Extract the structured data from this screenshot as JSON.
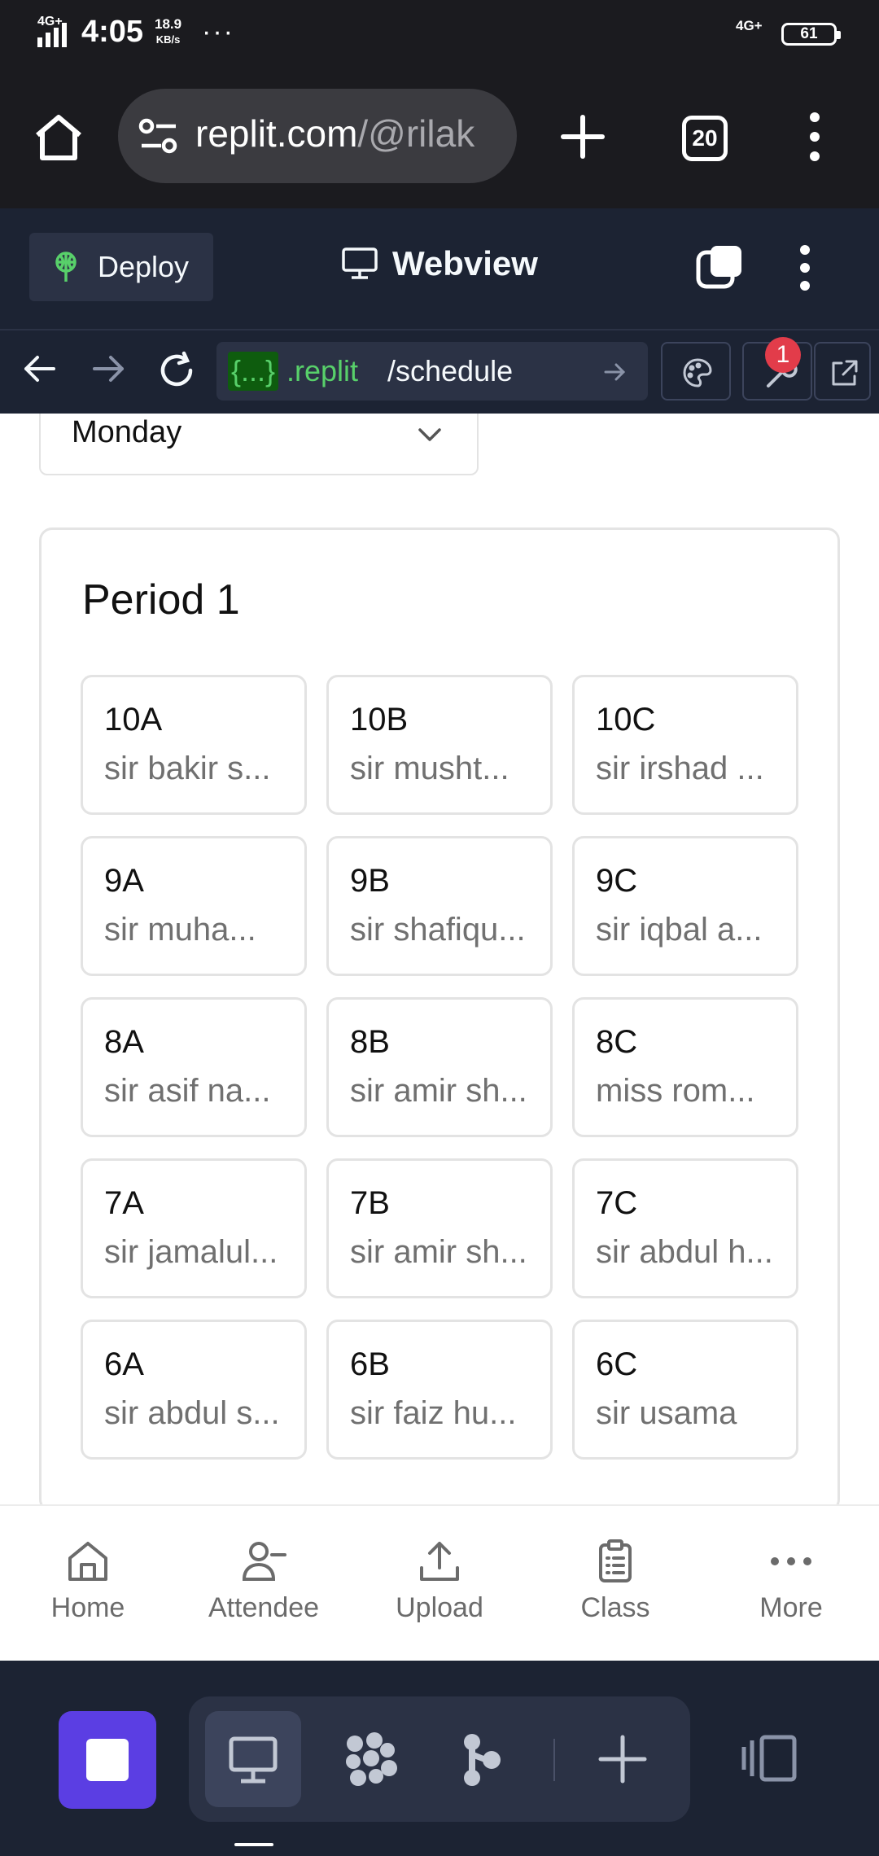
{
  "status_bar": {
    "network_left": "4G+",
    "time": "4:05",
    "net_speed_value": "18.9",
    "net_speed_unit": "KB/s",
    "overflow": "···",
    "network_right": "4G+",
    "battery": "61"
  },
  "browser": {
    "url_host": "replit.com",
    "url_rest": "/@rilak",
    "tab_count": "20"
  },
  "replit_header": {
    "deploy_label": "Deploy",
    "webview_label": "Webview"
  },
  "url_bar": {
    "badge": "{...}",
    "domain": ".replit",
    "path": "/schedule",
    "notification_count": "1"
  },
  "schedule": {
    "day": "Monday",
    "period_title": "Period 1",
    "cells": [
      {
        "cls": "10A",
        "teacher": "sir bakir s..."
      },
      {
        "cls": "10B",
        "teacher": "sir musht..."
      },
      {
        "cls": "10C",
        "teacher": "sir irshad ..."
      },
      {
        "cls": "9A",
        "teacher": "sir muha..."
      },
      {
        "cls": "9B",
        "teacher": "sir shafiqu..."
      },
      {
        "cls": "9C",
        "teacher": "sir iqbal a..."
      },
      {
        "cls": "8A",
        "teacher": "sir asif na..."
      },
      {
        "cls": "8B",
        "teacher": "sir amir sh..."
      },
      {
        "cls": "8C",
        "teacher": "miss rom..."
      },
      {
        "cls": "7A",
        "teacher": "sir jamalul..."
      },
      {
        "cls": "7B",
        "teacher": "sir amir sh..."
      },
      {
        "cls": "7C",
        "teacher": "sir abdul h..."
      },
      {
        "cls": "6A",
        "teacher": "sir abdul s..."
      },
      {
        "cls": "6B",
        "teacher": "sir faiz hu..."
      },
      {
        "cls": "6C",
        "teacher": "sir usama"
      }
    ]
  },
  "app_nav": [
    {
      "label": "Home",
      "icon": "home-icon"
    },
    {
      "label": "Attendee",
      "icon": "user-minus-icon"
    },
    {
      "label": "Upload",
      "icon": "upload-icon"
    },
    {
      "label": "Class",
      "icon": "clipboard-icon"
    },
    {
      "label": "More",
      "icon": "more-horizontal-icon"
    }
  ],
  "colors": {
    "stop_button": "#5b3ee3",
    "badge_red": "#e23c4a",
    "replit_bg": "#1c2333",
    "domain_green": "#58d06a"
  }
}
